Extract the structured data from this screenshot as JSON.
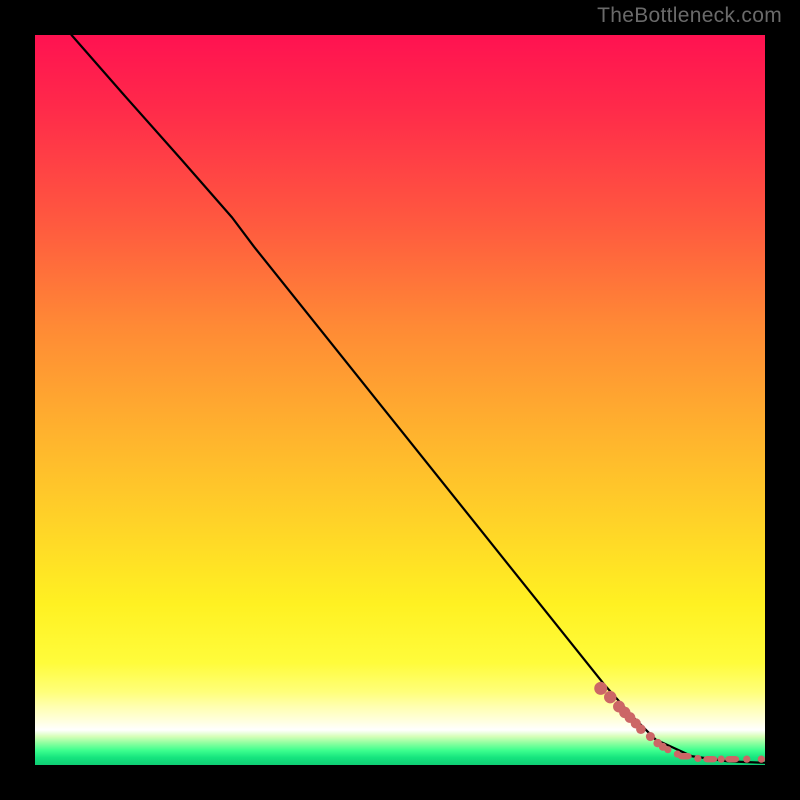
{
  "watermark": "TheBottleneck.com",
  "chart_data": {
    "type": "line",
    "title": "",
    "xlabel": "",
    "ylabel": "",
    "xlim": [
      0,
      100
    ],
    "ylim": [
      0,
      100
    ],
    "series": [
      {
        "name": "black-curve",
        "type": "line",
        "x": [
          5,
          12,
          20,
          27,
          30,
          40,
          50,
          60,
          70,
          78,
          82,
          85,
          90,
          95,
          100
        ],
        "y": [
          100,
          92,
          83,
          75,
          71,
          58.5,
          46,
          33.5,
          21,
          11,
          6.5,
          3.5,
          1.2,
          0.5,
          0.3
        ]
      },
      {
        "name": "red-dots",
        "type": "scatter",
        "x": [
          77.5,
          78.8,
          80.0,
          80.8,
          81.5,
          82.3,
          83.0,
          84.3,
          85.3,
          86.0,
          86.7,
          88.0,
          89.0,
          90.8,
          92.5,
          94.0,
          95.5,
          97.5,
          99.5
        ],
        "y": [
          10.5,
          9.3,
          8.0,
          7.2,
          6.5,
          5.7,
          4.9,
          3.9,
          3.0,
          2.5,
          2.1,
          1.5,
          1.2,
          0.9,
          0.8,
          0.8,
          0.8,
          0.8,
          0.8
        ]
      }
    ],
    "gradient_stops": [
      {
        "pos": 0.0,
        "color": "#ff1251"
      },
      {
        "pos": 0.4,
        "color": "#ff8a35"
      },
      {
        "pos": 0.78,
        "color": "#fff122"
      },
      {
        "pos": 0.95,
        "color": "#ffffff"
      },
      {
        "pos": 1.0,
        "color": "#0fcd74"
      }
    ]
  }
}
